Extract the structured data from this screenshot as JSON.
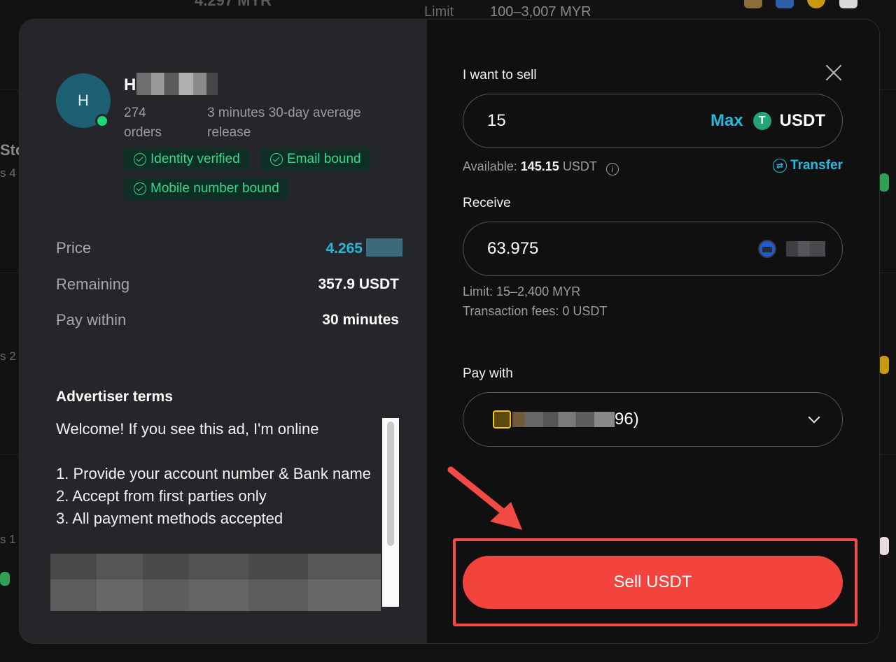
{
  "background": {
    "top_amount": "4.297 MYR",
    "limit_label": "Limit",
    "limit_value": "100–3,007 MYR",
    "side_texts": [
      "Sto",
      "s 4",
      "s 2",
      "s 1"
    ]
  },
  "advertiser": {
    "avatar_letter": "H",
    "name": "H",
    "orders_count": "274",
    "orders_label": "orders",
    "release_time": "3 minutes 30-day average",
    "release_label": "release",
    "badges": [
      "Identity verified",
      "Email bound",
      "Mobile number bound"
    ]
  },
  "details": {
    "price_label": "Price",
    "price_value": "4.265",
    "remaining_label": "Remaining",
    "remaining_value": "357.9 USDT",
    "pay_within_label": "Pay within",
    "pay_within_value": "30 minutes"
  },
  "terms": {
    "title": "Advertiser terms",
    "lines": [
      "Welcome! If you see this ad, I'm online",
      "",
      "1. Provide your account number & Bank name",
      "2. Accept from first parties only",
      "3. All payment methods accepted"
    ]
  },
  "trade": {
    "sell_label": "I want to sell",
    "sell_value": "15",
    "max_label": "Max",
    "coin": "USDT",
    "coin_icon_glyph": "T",
    "available_label": "Available:",
    "available_amount": "145.15",
    "available_unit": "USDT",
    "transfer_label": "Transfer",
    "receive_label": "Receive",
    "receive_value": "63.975",
    "limit_text": "Limit: 15–2,400 MYR",
    "fees_text": "Transaction fees: 0 USDT",
    "pay_with_label": "Pay with",
    "pay_method_suffix": "96)",
    "sell_button": "Sell USDT"
  },
  "colors": {
    "accent": "#27b8da",
    "success": "#2fdc8e",
    "sell": "#f3433d",
    "highlight": "#f34a43"
  }
}
